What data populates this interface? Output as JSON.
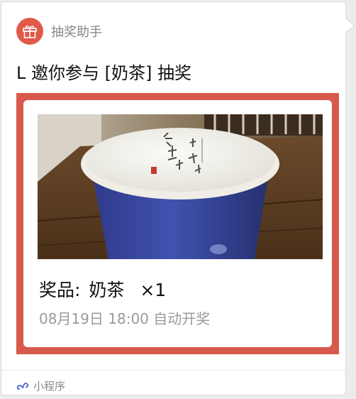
{
  "header": {
    "app_icon": "gift-icon",
    "app_name": "抽奖助手"
  },
  "title": "L 邀你参与 [奶茶] 抽奖",
  "card": {
    "frame_color": "#d85a4d",
    "prize_label": "奖品:",
    "prize_name": "奶茶",
    "prize_quantity": "×1",
    "draw_time": "08月19日 18:00 自动开奖"
  },
  "footer": {
    "icon": "mini-program-icon",
    "label": "小程序"
  },
  "colors": {
    "accent": "#e05a4a",
    "cup_blue": "#3c4aa0"
  }
}
